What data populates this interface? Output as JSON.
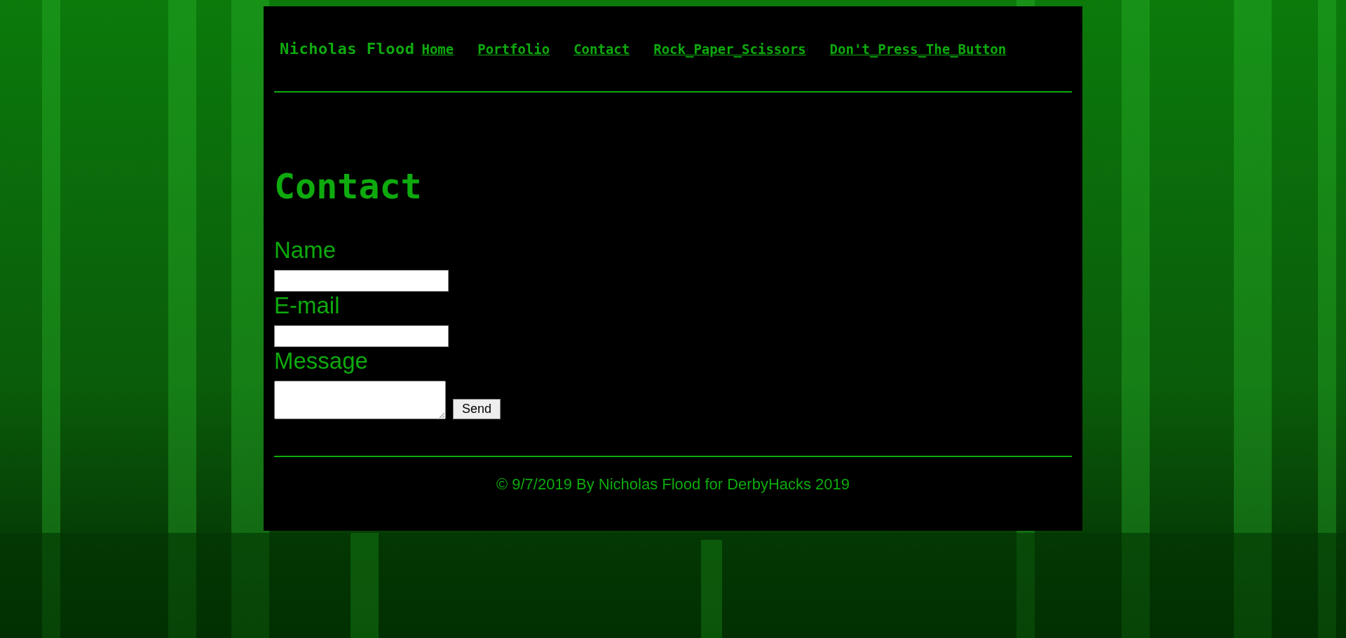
{
  "nav": {
    "brand": "Nicholas Flood",
    "links": [
      {
        "label": "Home"
      },
      {
        "label": "Portfolio"
      },
      {
        "label": "Contact"
      },
      {
        "label": "Rock_Paper_Scissors"
      },
      {
        "label": "Don't_Press_The_Button"
      }
    ]
  },
  "heading": "Contact",
  "form": {
    "fields": [
      {
        "label": "Name",
        "kind": "input"
      },
      {
        "label": "E-mail",
        "kind": "input"
      },
      {
        "label": "Message",
        "kind": "textarea"
      }
    ],
    "button": "Send"
  },
  "footer": "© 9/7/2019 By Nicholas Flood for DerbyHacks 2019"
}
